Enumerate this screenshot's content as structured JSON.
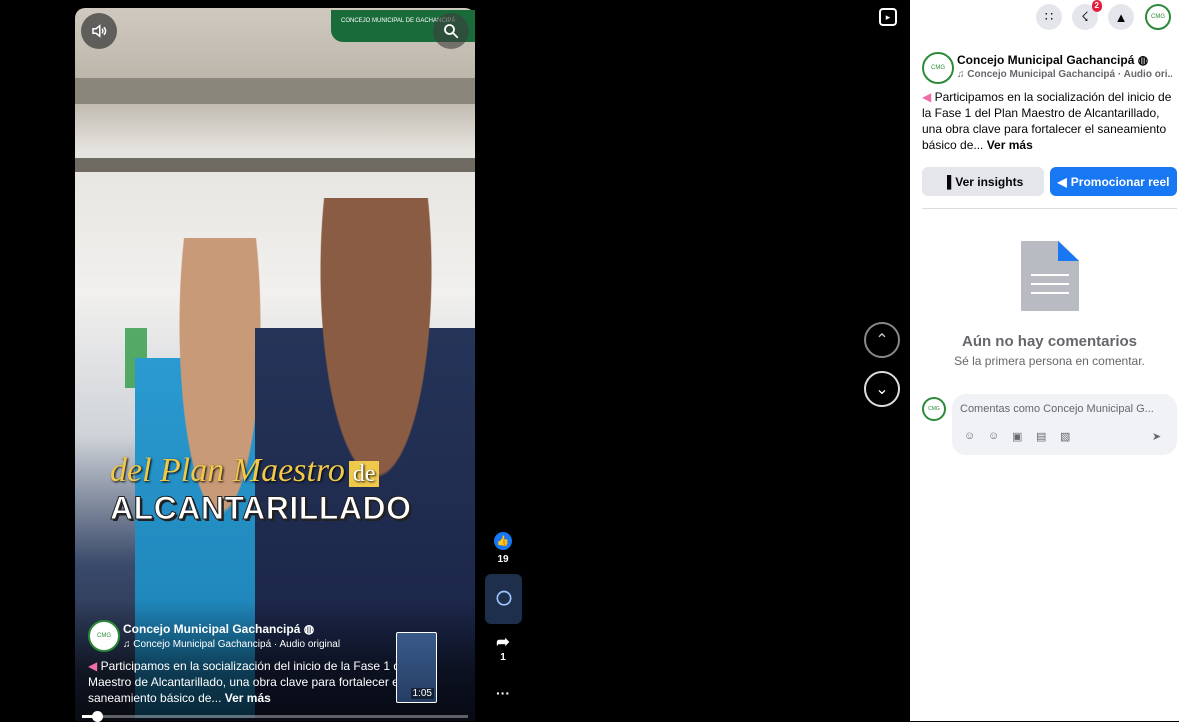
{
  "reel": {
    "page_name": "Concejo Municipal Gachancipá",
    "audio": "Concejo Municipal Gachancipá · Audio original",
    "caption": "Participamos en la socialización del inicio de la Fase 1 del Plan Maestro de Alcantarillado, una obra clave para fortalecer el saneamiento básico de...",
    "see_more": "Ver más",
    "overlay_line1": "del Plan Maestro",
    "overlay_de": "de",
    "overlay_line2": "ALCANTARILLADO",
    "logo_text": "CONCEJO MUNICIPAL DE GACHANCIPÁ",
    "next_duration": "1:05",
    "progress": 0.04,
    "likes": "19",
    "shares": "1",
    "more": "···"
  },
  "side": {
    "page_name": "Concejo Municipal Gachancipá",
    "audio": "Concejo Municipal Gachancipá · Audio ori...",
    "caption": "Participamos en la socialización del inicio de la Fase 1 del Plan Maestro de Alcantarillado, una obra clave para fortalecer el saneamiento básico de...",
    "see_more": "Ver más",
    "insights_label": "Ver insights",
    "promote_label": "Promocionar reel",
    "empty_title": "Aún no hay comentarios",
    "empty_sub": "Sé la primera persona en comentar.",
    "comment_placeholder": "Comentas como Concejo Municipal G..."
  },
  "topbar": {
    "notifications_badge": "2"
  },
  "icons": {
    "sound": "speaker-icon",
    "search": "search-icon",
    "like": "thumbs-up-icon",
    "comment": "comment-icon",
    "share": "share-icon",
    "up": "chevron-up-icon",
    "down": "chevron-down-icon",
    "menu": "grid-menu-icon",
    "messenger": "messenger-icon",
    "bell": "bell-icon"
  },
  "colors": {
    "brand_blue": "#1877f2",
    "logo_green": "#1a6b3a"
  }
}
